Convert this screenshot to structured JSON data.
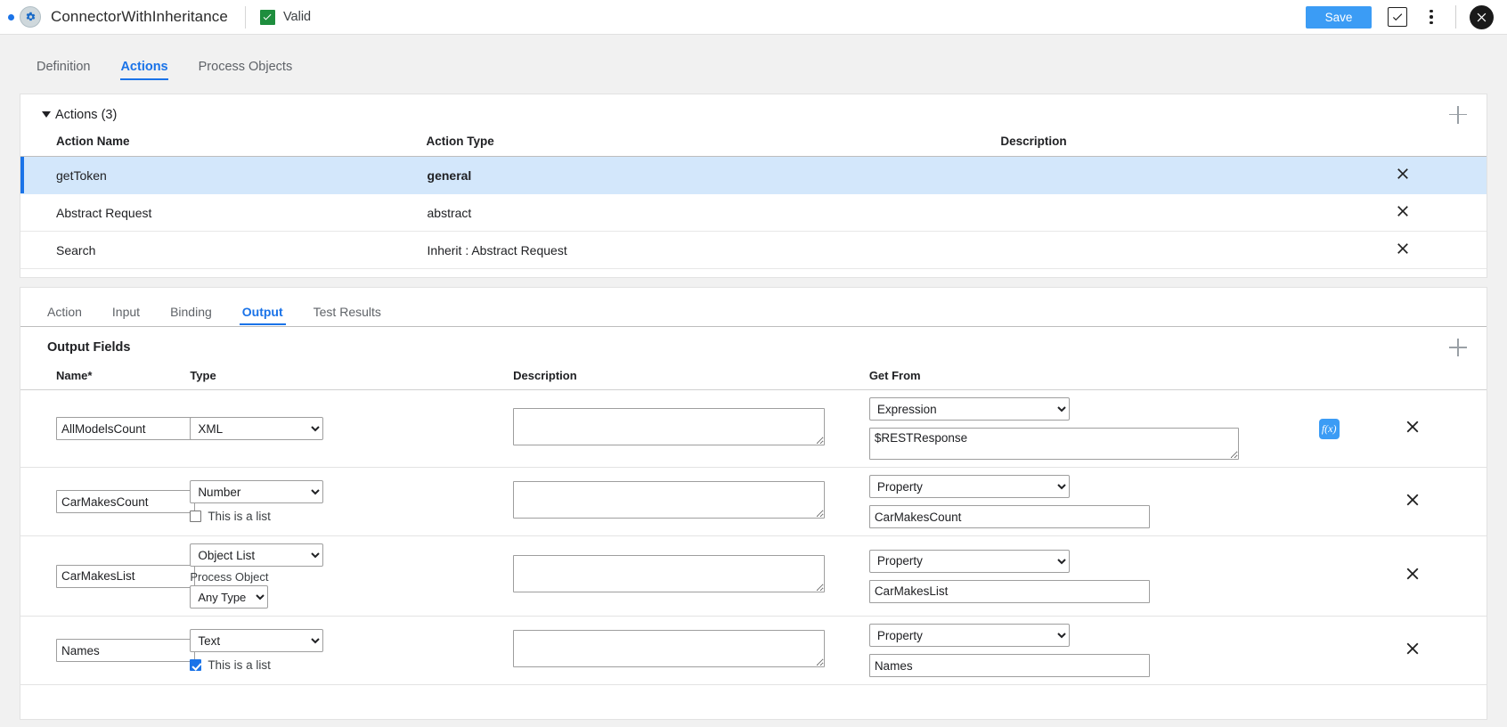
{
  "titlebar": {
    "app_title": "ConnectorWithInheritance",
    "status_label": "Valid",
    "status_icon": "green-check-icon",
    "save_label": "Save",
    "approve_icon": "checkbox-check-icon",
    "more_icon": "kebab-menu-icon",
    "close_icon": "close-circle-icon",
    "accent_blue": "#3b9cf5",
    "valid_green": "#1e8e3e"
  },
  "top_tabs": [
    {
      "label": "Definition",
      "active": false
    },
    {
      "label": "Actions",
      "active": true
    },
    {
      "label": "Process Objects",
      "active": false
    }
  ],
  "actions_panel": {
    "title": "Actions (3)",
    "collapse_icon": "caret-down-icon",
    "add_icon": "plus-icon",
    "columns": [
      "Action Name",
      "Action Type",
      "Description"
    ],
    "rows": [
      {
        "name": "getToken",
        "type": "general",
        "description": "",
        "selected": true
      },
      {
        "name": "Abstract Request",
        "type": "abstract",
        "description": "",
        "selected": false
      },
      {
        "name": "Search",
        "type": "Inherit : Abstract Request",
        "description": "",
        "selected": false
      }
    ],
    "delete_icon": "close-x-icon"
  },
  "inner_tabs": [
    {
      "label": "Action",
      "active": false
    },
    {
      "label": "Input",
      "active": false
    },
    {
      "label": "Binding",
      "active": false
    },
    {
      "label": "Output",
      "active": true
    },
    {
      "label": "Test Results",
      "active": false
    }
  ],
  "output_fields": {
    "title": "Output Fields",
    "add_icon": "plus-icon",
    "columns": [
      "Name*",
      "Type",
      "Description",
      "Get From"
    ],
    "list_checkbox_label": "This is a list",
    "process_object_label": "Process Object",
    "fx_label": "f(x)",
    "delete_icon": "close-x-icon",
    "rows": [
      {
        "name": "AllModelsCount",
        "type": "XML",
        "has_list_checkbox": false,
        "is_list": false,
        "has_process_object": false,
        "process_object": "",
        "description": "",
        "get_from": "Expression",
        "get_value": "$RESTResponse",
        "get_value_is_textarea": true,
        "has_fx": true
      },
      {
        "name": "CarMakesCount",
        "type": "Number",
        "has_list_checkbox": true,
        "is_list": false,
        "has_process_object": false,
        "process_object": "",
        "description": "",
        "get_from": "Property",
        "get_value": "CarMakesCount",
        "get_value_is_textarea": false,
        "has_fx": false
      },
      {
        "name": "CarMakesList",
        "type": "Object List",
        "has_list_checkbox": false,
        "is_list": false,
        "has_process_object": true,
        "process_object": "Any Type",
        "description": "",
        "get_from": "Property",
        "get_value": "CarMakesList",
        "get_value_is_textarea": false,
        "has_fx": false
      },
      {
        "name": "Names",
        "type": "Text",
        "has_list_checkbox": true,
        "is_list": true,
        "has_process_object": false,
        "process_object": "",
        "description": "",
        "get_from": "Property",
        "get_value": "Names",
        "get_value_is_textarea": false,
        "has_fx": false
      }
    ]
  }
}
